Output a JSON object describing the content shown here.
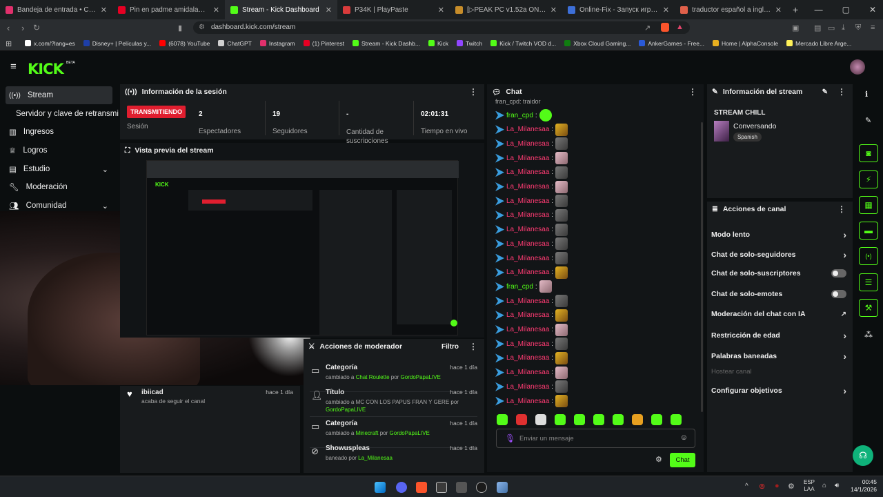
{
  "browser": {
    "tabs": [
      {
        "title": "Bandeja de entrada • Chat",
        "color": "#e1306c"
      },
      {
        "title": "Pin en padme amidala💗ANAKIN SK",
        "color": "#e60023"
      },
      {
        "title": "Stream - Kick Dashboard",
        "color": "#53fc18",
        "active": true
      },
      {
        "title": "P34K | PlayPaste",
        "color": "#d93b3b"
      },
      {
        "title": "[▷PEAK PC v1.52a ONLINE STEAM | F",
        "color": "#c78d2a"
      },
      {
        "title": "Online-Fix - Запуск игр по сети",
        "color": "#3d6fd8"
      },
      {
        "title": "traductor español a inglés - Brave Se",
        "color": "#e0604a"
      }
    ],
    "url": "dashboard.kick.com/stream",
    "bookmarks": [
      {
        "label": "x.com/?lang=es",
        "color": "#ffffff"
      },
      {
        "label": "Disney+ | Películas y...",
        "color": "#1e3fa8"
      },
      {
        "label": "(6078) YouTube",
        "color": "#ff0000"
      },
      {
        "label": "ChatGPT",
        "color": "#d0d0d0"
      },
      {
        "label": "Instagram",
        "color": "#e1306c"
      },
      {
        "label": "(1) Pinterest",
        "color": "#e60023"
      },
      {
        "label": "Stream - Kick Dashb...",
        "color": "#53fc18"
      },
      {
        "label": "Kick",
        "color": "#53fc18"
      },
      {
        "label": "Twitch",
        "color": "#9146ff"
      },
      {
        "label": "Kick / Twitch VOD d...",
        "color": "#53fc18"
      },
      {
        "label": "Xbox Cloud Gaming...",
        "color": "#107c10"
      },
      {
        "label": "AnkerGames - Free...",
        "color": "#2a5ad8"
      },
      {
        "label": "Home | AlphaConsole",
        "color": "#e8b020"
      },
      {
        "label": "Mercado Libre Arge...",
        "color": "#fff159"
      }
    ]
  },
  "app": {
    "logo": "KICK",
    "beta": "BETA"
  },
  "sidebar": {
    "items": [
      {
        "label": "Stream",
        "icon": "broadcast-icon"
      },
      {
        "label": "Servidor y clave de retransmi"
      },
      {
        "label": "Ingresos",
        "icon": "chart-icon"
      },
      {
        "label": "Logros",
        "icon": "trophy-icon"
      },
      {
        "label": "Estudio",
        "icon": "studio-icon"
      },
      {
        "label": "Moderación",
        "icon": "wrench-icon"
      },
      {
        "label": "Comunidad",
        "icon": "community-icon"
      }
    ]
  },
  "session": {
    "title": "Información de la sesión",
    "badge": "TRANSMITIENDO",
    "badge_label": "Sesión",
    "stats": [
      {
        "value": "2",
        "label": "Espectadores"
      },
      {
        "value": "19",
        "label": "Seguidores"
      },
      {
        "value": "-",
        "label": "Cantidad de suscripciones"
      },
      {
        "value": "02:01:31",
        "label": "Tiempo en vivo"
      }
    ]
  },
  "preview": {
    "title": "Vista previa del stream"
  },
  "follow_event": {
    "name": "ibiicad",
    "text": "acaba de seguir el canal",
    "time": "hace 1 día"
  },
  "mod_actions": {
    "title": "Acciones de moderador",
    "filter": "Filtro",
    "rows": [
      {
        "title": "Categoría",
        "time": "hace 1 día",
        "pre": "cambiado a ",
        "a": "Chat Roulette",
        "mid": " por ",
        "b": "GordoPapaLIVE"
      },
      {
        "title": "Título",
        "time": "hace 1 día",
        "pre": "cambiado a MC CON LOS PAPUS FRAN Y GERE por ",
        "a": "",
        "mid": "",
        "b": "GordoPapaLIVE"
      },
      {
        "title": "Categoría",
        "time": "hace 1 día",
        "pre": "cambiado a ",
        "a": "Minecraft",
        "mid": " por ",
        "b": "GordoPapaLIVE"
      },
      {
        "title": "Showuspleas",
        "time": "hace 1 día",
        "pre": "baneado por ",
        "a": "",
        "mid": "",
        "b": "La_Milanesaa"
      }
    ]
  },
  "chat": {
    "title": "Chat",
    "top_partial": "fran_cpd: traidor",
    "messages": [
      {
        "user": "fran_cpd",
        "g": true,
        "e": "em4"
      },
      {
        "user": "La_Milanesaa",
        "e": "em1"
      },
      {
        "user": "La_Milanesaa",
        "e": "em2"
      },
      {
        "user": "La_Milanesaa",
        "e": "em3"
      },
      {
        "user": "La_Milanesaa",
        "e": "em2"
      },
      {
        "user": "La_Milanesaa",
        "e": "em3"
      },
      {
        "user": "La_Milanesaa",
        "e": "em2"
      },
      {
        "user": "La_Milanesaa",
        "e": "em2"
      },
      {
        "user": "La_Milanesaa",
        "e": "em2"
      },
      {
        "user": "La_Milanesaa",
        "e": "em2"
      },
      {
        "user": "La_Milanesaa",
        "e": "em2"
      },
      {
        "user": "La_Milanesaa",
        "e": "em1"
      },
      {
        "user": "fran_cpd",
        "g": true,
        "e": "em3"
      },
      {
        "user": "La_Milanesaa",
        "e": "em2"
      },
      {
        "user": "La_Milanesaa",
        "e": "em1"
      },
      {
        "user": "La_Milanesaa",
        "e": "em3"
      },
      {
        "user": "La_Milanesaa",
        "e": "em2"
      },
      {
        "user": "La_Milanesaa",
        "e": "em1"
      },
      {
        "user": "La_Milanesaa",
        "e": "em3"
      },
      {
        "user": "La_Milanesaa",
        "e": "em2"
      },
      {
        "user": "La_Milanesaa",
        "e": "em1"
      }
    ],
    "input_placeholder": "Enviar un mensaje",
    "send": "Chat"
  },
  "stream_info": {
    "title": "Información del stream",
    "stream_title": "STREAM CHILL",
    "category": "Conversando",
    "language": "Spanish"
  },
  "channel_actions": {
    "title": "Acciones de canal",
    "items": [
      {
        "label": "Modo lento",
        "type": "arrow"
      },
      {
        "label": "Chat de solo-seguidores",
        "type": "arrow"
      },
      {
        "label": "Chat de solo-suscriptores",
        "type": "toggle"
      },
      {
        "label": "Chat de solo-emotes",
        "type": "toggle"
      },
      {
        "label": "Moderación del chat con IA",
        "type": "ext"
      },
      {
        "label": "Restricción de edad",
        "type": "arrow"
      },
      {
        "label": "Palabras baneadas",
        "type": "arrow"
      },
      {
        "label": "Hostear canal",
        "type": "disabled"
      },
      {
        "label": "Configurar objetivos",
        "type": "arrow"
      }
    ]
  },
  "taskbar": {
    "lang": "ESP",
    "lang2": "LAA",
    "time": "00:45",
    "date": "14/1/2026"
  }
}
